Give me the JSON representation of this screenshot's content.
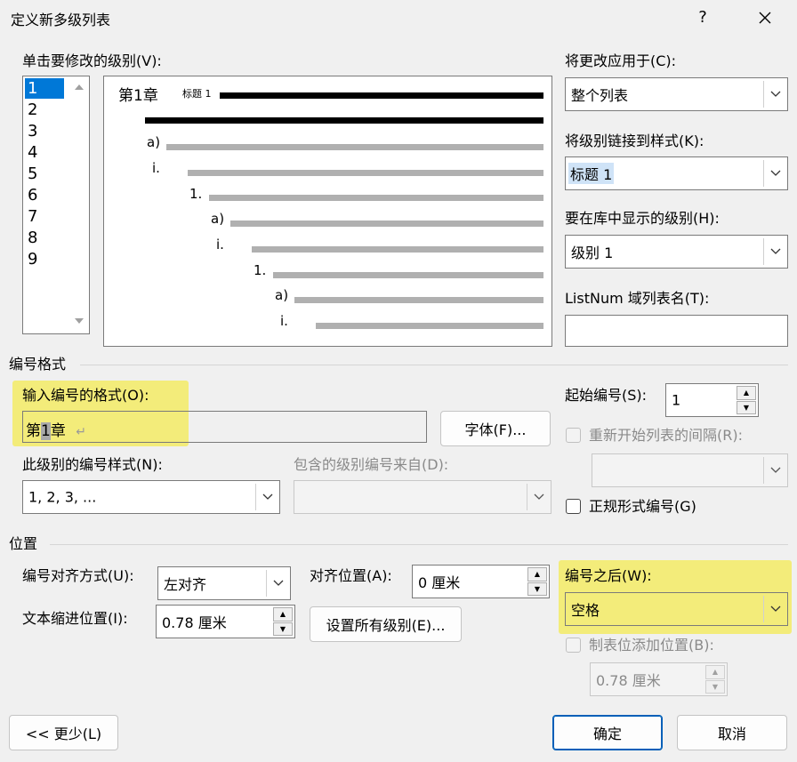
{
  "window": {
    "title": "定义新多级列表",
    "help": "?",
    "close": "✕"
  },
  "level_list": {
    "label": "单击要修改的级别(V):",
    "items": [
      "1",
      "2",
      "3",
      "4",
      "5",
      "6",
      "7",
      "8",
      "9"
    ],
    "selected": "1"
  },
  "preview": {
    "first_line_number": "第1章",
    "first_line_style": "标题 1",
    "numbers": [
      "a)",
      "i.",
      "1.",
      "a)",
      "i.",
      "1.",
      "a)",
      "i."
    ]
  },
  "apply_to": {
    "label": "将更改应用于(C):",
    "value": "整个列表"
  },
  "link_style": {
    "label": "将级别链接到样式(K):",
    "value": "标题 1"
  },
  "gallery_level": {
    "label": "要在库中显示的级别(H):",
    "value": "级别 1"
  },
  "listnum": {
    "label": "ListNum 域列表名(T):",
    "value": ""
  },
  "number_format_section": {
    "title": "编号格式",
    "format_label": "输入编号的格式(O):",
    "format_value_pre": "第",
    "format_value_num": "1",
    "format_value_post": "章",
    "format_mark": "↵",
    "font_button": "字体(F)...",
    "style_label": "此级别的编号样式(N):",
    "style_value": "1, 2, 3, ...",
    "include_label": "包含的级别编号来自(D):",
    "include_value": "",
    "start_label": "起始编号(S):",
    "start_value": "1",
    "restart_label": "重新开始列表的间隔(R):",
    "restart_value": "",
    "legal_label": "正规形式编号(G)"
  },
  "position_section": {
    "title": "位置",
    "align_label": "编号对齐方式(U):",
    "align_value": "左对齐",
    "at_label": "对齐位置(A):",
    "at_value": "0 厘米",
    "indent_label": "文本缩进位置(I):",
    "indent_value": "0.78 厘米",
    "set_all_button": "设置所有级别(E)...",
    "follow_label": "编号之后(W):",
    "follow_value": "空格",
    "tab_label": "制表位添加位置(B):",
    "tab_value": "0.78 厘米"
  },
  "footer": {
    "less": "<< 更少(L)",
    "ok": "确定",
    "cancel": "取消"
  },
  "colors": {
    "highlight": "#f3ec7a",
    "selection": "#0078d7",
    "primary_border": "#005fb8"
  }
}
